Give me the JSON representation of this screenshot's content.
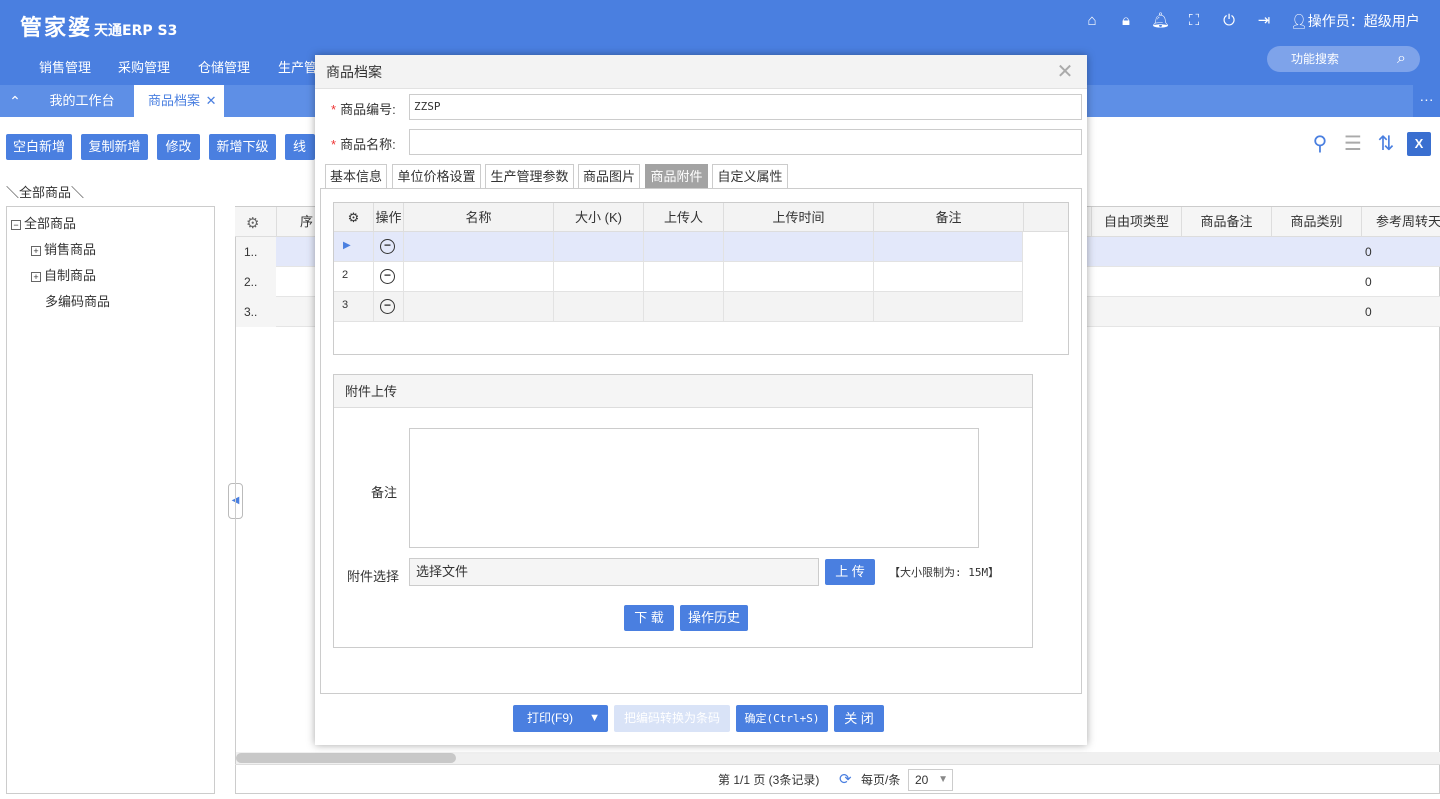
{
  "app": {
    "logo_main": "管家婆",
    "logo_sub": "天通ERP S3"
  },
  "header": {
    "operator": "操作员：超级用户",
    "nav": [
      "销售管理",
      "采购管理",
      "仓储管理",
      "生产管"
    ],
    "search_label": "功能搜索"
  },
  "tabs": {
    "work": "我的工作台",
    "goods": "商品档案"
  },
  "toolbar": {
    "buttons": [
      "空白新增",
      "复制新增",
      "修改",
      "新增下级",
      "线性"
    ]
  },
  "breadcrumb": "＼全部商品＼",
  "tree": {
    "root": "全部商品",
    "children": [
      "销售商品",
      "自制商品",
      "多编码商品"
    ]
  },
  "grid": {
    "headers": {
      "seq": "序",
      "free_type": "自由项类型",
      "remark": "商品备注",
      "category": "商品类别",
      "turnover": "参考周转天"
    },
    "rows": [
      {
        "num": "1..",
        "turnover": "0"
      },
      {
        "num": "2..",
        "turnover": "0"
      },
      {
        "num": "3..",
        "turnover": "0"
      }
    ]
  },
  "pager": {
    "text": "第 1/1 页 (3条记录)",
    "per_page_label": "每页/条",
    "per_page": "20"
  },
  "modal": {
    "title": "商品档案",
    "code_label": "商品编号:",
    "code_value": "ZZSP",
    "name_label": "商品名称:",
    "name_value": "",
    "tabs": [
      "基本信息",
      "单位价格设置",
      "生产管理参数",
      "商品图片",
      "商品附件",
      "自定义属性"
    ],
    "active_tab": "商品附件",
    "att_headers": [
      "操作",
      "名称",
      "大小 (K)",
      "上传人",
      "上传时间",
      "备注"
    ],
    "att_rows": [
      "",
      "2",
      "3"
    ],
    "upload": {
      "title": "附件上传",
      "remark_label": "备注",
      "file_label": "附件选择",
      "file_placeholder": "选择文件",
      "upload_btn": "上 传",
      "size_note": "【大小限制为: 15M】",
      "download_btn": "下 载",
      "history_btn": "操作历史"
    },
    "footer": {
      "print": "打印(F9)",
      "convert": "把编码转换为条码",
      "ok": "确定(Ctrl+S)",
      "close": "关 闭"
    }
  },
  "colors": {
    "primary": "#4a7fe0",
    "tab_bar": "#5e8fe6",
    "row_selected": "#e3e8fa"
  }
}
